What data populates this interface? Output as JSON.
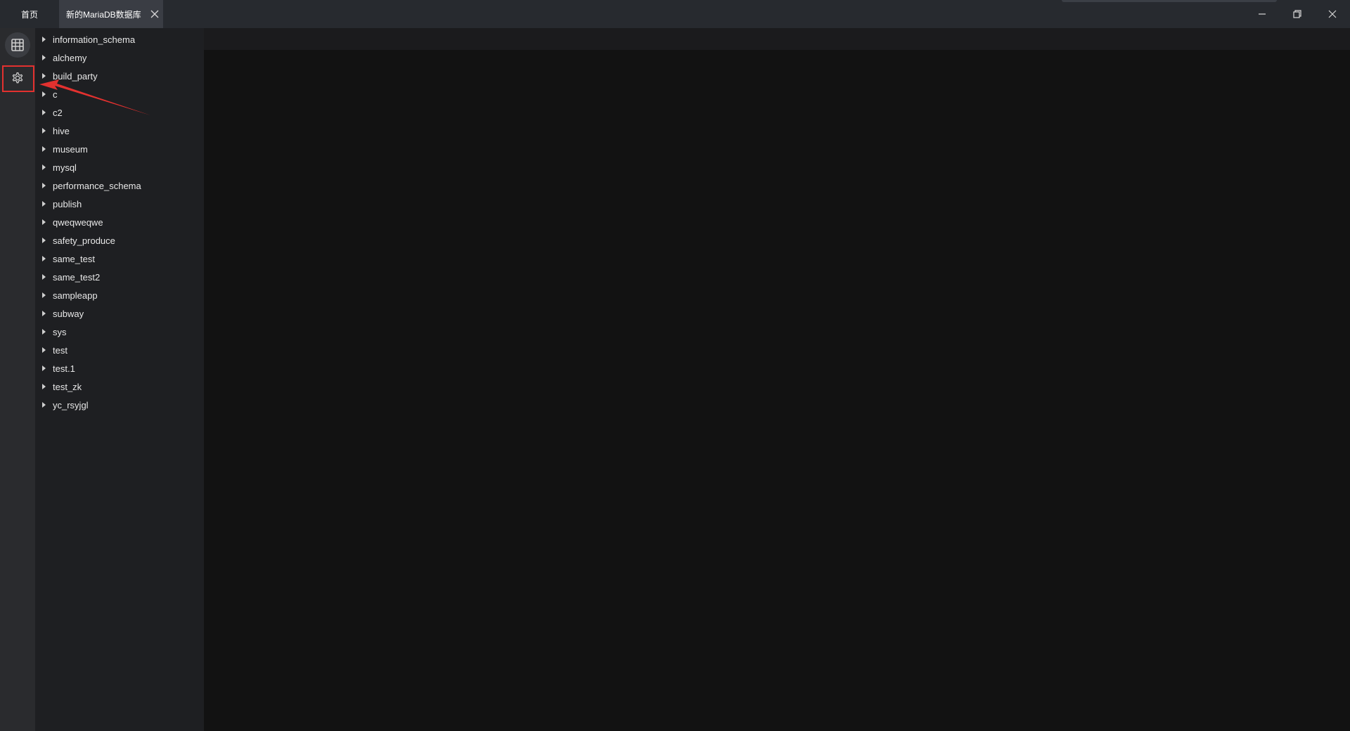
{
  "tabs": {
    "home_label": "首页",
    "db_label": "新的MariaDB数据库"
  },
  "window_controls": [
    "minimize",
    "restore",
    "close"
  ],
  "sidebar": {
    "icons": [
      "database-icon",
      "settings-icon"
    ]
  },
  "tree": {
    "items": [
      "information_schema",
      "alchemy",
      "build_party",
      "c",
      "c2",
      "hive",
      "museum",
      "mysql",
      "performance_schema",
      "publish",
      "qweqweqwe",
      "safety_produce",
      "same_test",
      "same_test2",
      "sampleapp",
      "subway",
      "sys",
      "test",
      "test.1",
      "test_zk",
      "yc_rsyjgl"
    ]
  },
  "colors": {
    "titlebar": "#272a2f",
    "active_tab": "#3a3d44",
    "activity_bar": "#2a2b2e",
    "tree_panel": "#1e1f22",
    "main_area": "#121212",
    "annotation": "#e3312f"
  }
}
